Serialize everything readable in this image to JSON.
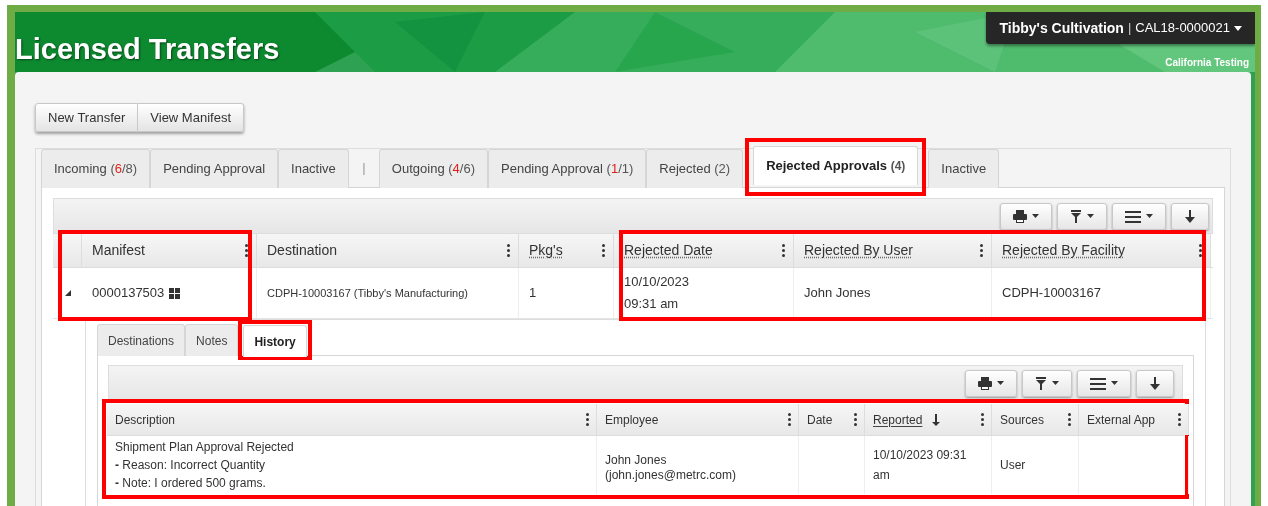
{
  "header": {
    "title": "Licensed Transfers",
    "facility": {
      "name": "Tibby's Cultivation",
      "separator": "|",
      "license": "CAL18-0000021"
    },
    "environment": "California Testing"
  },
  "actions": [
    "New Transfer",
    "View Manifest"
  ],
  "tabs": [
    {
      "kind": "tab",
      "label": "Incoming",
      "count": [
        {
          "text": "(",
          "alert": false
        },
        {
          "text": "6",
          "alert": true
        },
        {
          "text": "/8)",
          "alert": false
        }
      ],
      "selected": false,
      "highlighted": false
    },
    {
      "kind": "tab",
      "label": "Pending Approval",
      "selected": false,
      "highlighted": false
    },
    {
      "kind": "tab",
      "label": "Inactive",
      "selected": false,
      "highlighted": false
    },
    {
      "kind": "separator",
      "label": "|"
    },
    {
      "kind": "tab",
      "label": "Outgoing",
      "count": [
        {
          "text": "(",
          "alert": false
        },
        {
          "text": "4",
          "alert": true
        },
        {
          "text": "/6)",
          "alert": false
        }
      ],
      "selected": false,
      "highlighted": false
    },
    {
      "kind": "tab",
      "label": "Pending Approval",
      "count": [
        {
          "text": "(",
          "alert": false
        },
        {
          "text": "1",
          "alert": true
        },
        {
          "text": "/1)",
          "alert": false
        }
      ],
      "selected": false,
      "highlighted": false
    },
    {
      "kind": "tab",
      "label": "Rejected",
      "count": [
        {
          "text": "(2)",
          "alert": false
        }
      ],
      "selected": false,
      "highlighted": false
    },
    {
      "kind": "tab",
      "label": "Rejected Approvals",
      "count": [
        {
          "text": "(4)",
          "alert": false
        }
      ],
      "selected": true,
      "highlighted": true
    },
    {
      "kind": "tab",
      "label": "Inactive",
      "selected": false,
      "highlighted": false
    }
  ],
  "table": {
    "toolbar": [
      {
        "kind": "print",
        "caret": true
      },
      {
        "kind": "filter",
        "caret": true
      },
      {
        "kind": "columns",
        "caret": true
      },
      {
        "kind": "download",
        "caret": false
      }
    ],
    "columns": [
      {
        "label": "Manifest",
        "underlined": false,
        "highlighted": true
      },
      {
        "label": "Destination",
        "underlined": false,
        "highlighted": false
      },
      {
        "label": "Pkg's",
        "underlined": true,
        "highlighted": false
      },
      {
        "label": "Rejected Date",
        "underlined": true,
        "highlighted": true
      },
      {
        "label": "Rejected By User",
        "underlined": true,
        "highlighted": true
      },
      {
        "label": "Rejected By Facility",
        "underlined": true,
        "highlighted": true
      }
    ],
    "rows": [
      {
        "expanded": true,
        "cells": [
          [
            "0000137503"
          ],
          [
            "CDPH-10003167 (Tibby's Manufacturing)"
          ],
          [
            "1"
          ],
          [
            "10/10/2023",
            "09:31 am"
          ],
          [
            "John Jones"
          ],
          [
            "CDPH-10003167"
          ]
        ]
      }
    ]
  },
  "detail": {
    "tabs": [
      {
        "label": "Destinations",
        "selected": false,
        "highlighted": false
      },
      {
        "label": "Notes",
        "selected": false,
        "highlighted": false
      },
      {
        "label": "History",
        "selected": true,
        "highlighted": true
      }
    ],
    "history": {
      "highlighted": true,
      "toolbar": [
        {
          "kind": "print",
          "caret": true
        },
        {
          "kind": "filter",
          "caret": true
        },
        {
          "kind": "columns",
          "caret": true
        },
        {
          "kind": "download",
          "caret": false
        }
      ],
      "columns": [
        {
          "label": "Description",
          "underlined": false,
          "sorted": false
        },
        {
          "label": "Employee",
          "underlined": false,
          "sorted": false
        },
        {
          "label": "Date",
          "underlined": false,
          "sorted": false
        },
        {
          "label": "Reported",
          "underlined": true,
          "sorted": true
        },
        {
          "label": "Sources",
          "underlined": false,
          "sorted": false
        },
        {
          "label": "External App",
          "underlined": false,
          "sorted": false
        }
      ],
      "rows": [
        {
          "cells": [
            [
              "Shipment Plan Approval Rejected",
              "**-** Reason: Incorrect Quantity",
              "**-** Note: I ordered 500 grams."
            ],
            [
              "John Jones",
              "(john.jones@metrc.com)"
            ],
            [],
            [
              "10/10/2023 09:31 am"
            ],
            [
              "User"
            ],
            []
          ]
        }
      ]
    }
  }
}
